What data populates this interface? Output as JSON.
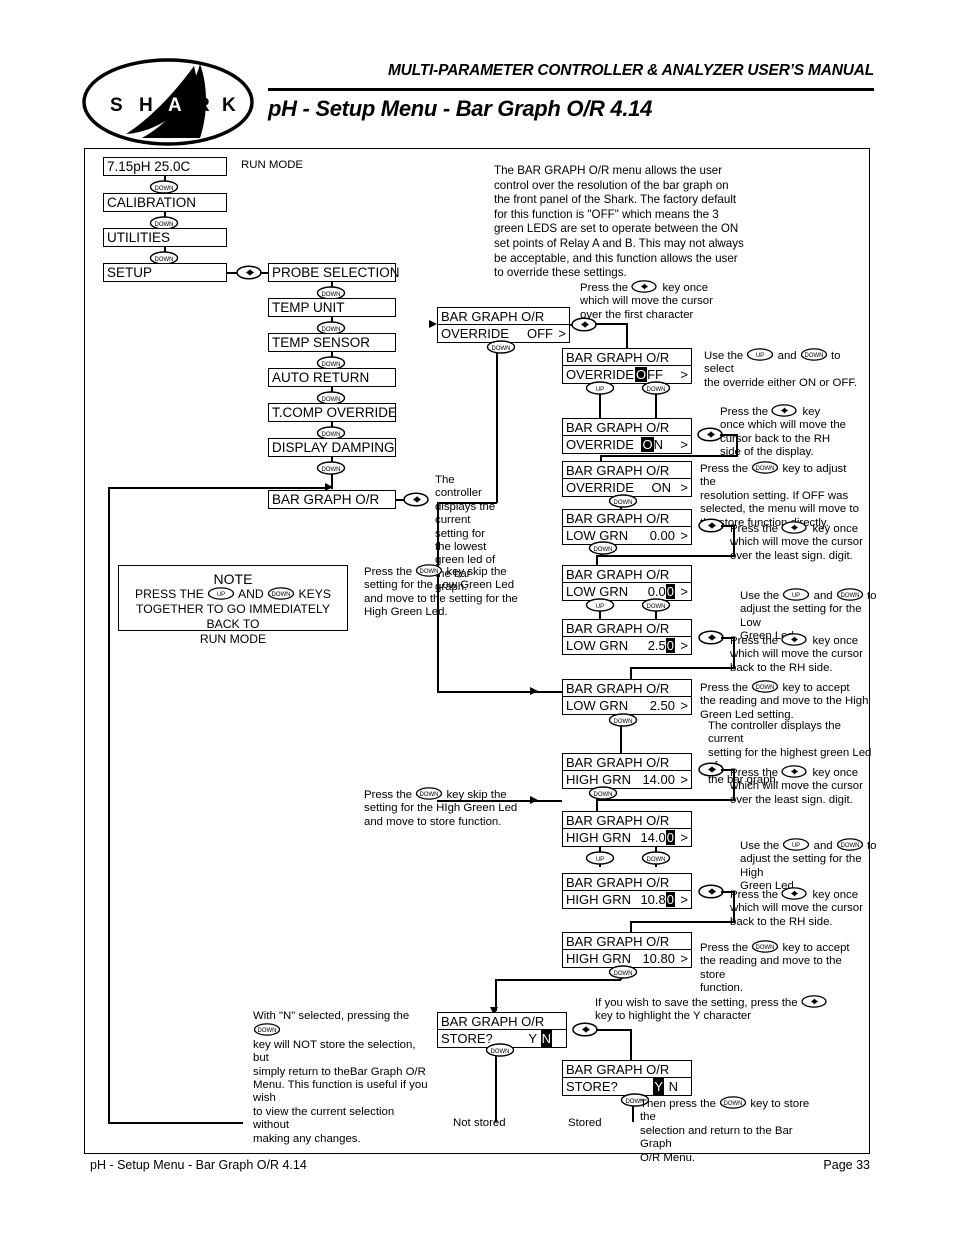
{
  "header": {
    "manual_title": "MULTI-PARAMETER CONTROLLER & ANALYZER USER’S MANUAL",
    "page_title": "pH - Setup Menu - Bar Graph O/R 4.14",
    "logo_text": "SHARK"
  },
  "footer": {
    "left": "pH - Setup Menu - Bar Graph O/R 4.14",
    "right": "Page 33"
  },
  "keys": {
    "up": "UP",
    "down": "DOWN",
    "left_right": "left-right"
  },
  "intro": "The BAR GRAPH O/R menu allows the user control over the resolution of the bar graph on the front panel of the Shark. The factory default for this function is \"OFF\" which means the 3  green LEDS are set to operate between the ON set points of Relay A and B.  This may not always be acceptable, and this function allows the user to override these settings.",
  "run_mode_label": "RUN MODE",
  "left_menu": [
    {
      "label": "7.15pH  25.0C"
    },
    {
      "label": "CALIBRATION"
    },
    {
      "label": "UTILITIES"
    },
    {
      "label": "SETUP"
    }
  ],
  "setup_menu": [
    {
      "label": "PROBE SELECTION"
    },
    {
      "label": "TEMP UNIT"
    },
    {
      "label": "TEMP SENSOR"
    },
    {
      "label": "AUTO RETURN"
    },
    {
      "label": "T.COMP OVERRIDE"
    },
    {
      "label": "DISPLAY DAMPING"
    },
    {
      "label": "BAR GRAPH O/R"
    }
  ],
  "screens": {
    "override_off": {
      "title": "BAR GRAPH O/R",
      "label": "OVERRIDE",
      "value": "OFF",
      "caret": ">"
    },
    "override_off_cursor": {
      "title": "BAR GRAPH O/R",
      "label": "OVERRIDE",
      "cursor_char": "O",
      "rest": "FF",
      "caret": ">"
    },
    "override_on_cursor": {
      "title": "BAR GRAPH O/R",
      "label": "OVERRIDE",
      "cursor_char": "O",
      "rest": "N",
      "caret": ">"
    },
    "override_on": {
      "title": "BAR GRAPH O/R",
      "label": "OVERRIDE",
      "value": "ON",
      "caret": ">"
    },
    "low_grn_000": {
      "title": "BAR GRAPH O/R",
      "label": "LOW GRN",
      "value": "0.00",
      "caret": ">"
    },
    "low_grn_000_cursor": {
      "title": "BAR GRAPH O/R",
      "label": "LOW GRN",
      "prefix": "0.0",
      "cursor_char": "0",
      "caret": ">"
    },
    "low_grn_250_cursor": {
      "title": "BAR GRAPH O/R",
      "label": "LOW GRN",
      "prefix": "2.5",
      "cursor_char": "0",
      "caret": ">"
    },
    "low_grn_250": {
      "title": "BAR GRAPH O/R",
      "label": "LOW GRN",
      "value": "2.50",
      "caret": ">"
    },
    "high_grn_1400": {
      "title": "BAR GRAPH O/R",
      "label": "HIGH GRN",
      "value": "14.00",
      "caret": ">"
    },
    "high_grn_1400_cursor": {
      "title": "BAR GRAPH O/R",
      "label": "HIGH GRN",
      "prefix": "14.0",
      "cursor_char": "0",
      "caret": ">"
    },
    "high_grn_1080_cursor": {
      "title": "BAR GRAPH O/R",
      "label": "HIGH GRN",
      "prefix": "10.8",
      "cursor_char": "0",
      "caret": ">"
    },
    "high_grn_1080": {
      "title": "BAR GRAPH O/R",
      "label": "HIGH GRN",
      "value": "10.80",
      "caret": ">"
    },
    "store_n": {
      "title": "BAR GRAPH O/R",
      "label": "STORE?",
      "yes": "Y",
      "no": "N"
    },
    "store_y": {
      "title": "BAR GRAPH O/R",
      "label": "STORE?",
      "yes": "Y",
      "no": "N"
    }
  },
  "annotations": {
    "press_lr_first_char": {
      "a": "Press the",
      "b": "key once",
      "c": "which will move the cursor",
      "d": "over the first character"
    },
    "use_up_down_override": {
      "a": "Use the",
      "b": "and",
      "c": "to select",
      "d": "the override either ON or OFF."
    },
    "press_lr_back_rh_display": {
      "a": "Press the",
      "b": "key",
      "c": "once which will move the",
      "d": "cursor back to the RH",
      "e": "side of the display."
    },
    "press_down_resolution": {
      "a": "Press the",
      "b": "key to adjust the",
      "c": "resolution setting. If OFF was",
      "d": "selected, the menu will move to",
      "e": "the store function directly."
    },
    "controller_lowest_green": "The controller displays the current setting for the lowest green led of the bar graph.",
    "press_lr_least_sig_1": {
      "a": "Press the",
      "b": "key once",
      "c": "which will move the cursor",
      "d": "over the least sign. digit."
    },
    "use_up_down_low": {
      "a": "Use the",
      "b": "and",
      "c": "to",
      "d": "adjust the setting for the Low",
      "e": "Green Led."
    },
    "press_lr_back_rh_1": {
      "a": "Press the",
      "b": "key once",
      "c": "which will move the cursor",
      "d": "back to the RH side."
    },
    "press_down_accept_high": {
      "a": "Press the",
      "b": "key to accept",
      "c": "the reading and move to the High",
      "d": "Green Led setting."
    },
    "controller_highest_green": {
      "a": "The controller displays the current",
      "b": "setting for the highest green Led of",
      "c": "the bar graph."
    },
    "press_lr_least_sig_2": {
      "a": "Press the",
      "b": "key once",
      "c": "which will move the cursor",
      "d": "over the least sign. digit."
    },
    "use_up_down_high": {
      "a": "Use the",
      "b": "and",
      "c": "to",
      "d": "adjust the setting for the High",
      "e": "Green Led."
    },
    "press_lr_back_rh_2": {
      "a": "Press the",
      "b": "key once",
      "c": "which will move the cursor",
      "d": "back to the RH side."
    },
    "press_down_accept_store": {
      "a": "Press the",
      "b": "key to accept",
      "c": "the reading and move to the store",
      "d": "function."
    },
    "skip_low_green": {
      "a": "Press the",
      "b": "key skip the",
      "c": "setting for the Low Green Led",
      "d": "and move to the setting for the",
      "e": "High Green Led."
    },
    "skip_high_green": {
      "a": "Press the",
      "b": "key skip the",
      "c": "setting for the HIgh Green Led",
      "d": "and move to store function."
    },
    "save_highlight_y": {
      "a": "If you wish to save the setting, press the",
      "b": "key to highlight the Y character"
    },
    "then_press_store": {
      "a": "Then press the",
      "b": "key to store the",
      "c": "selection and return to the Bar Graph",
      "d": "O/R Menu."
    },
    "with_n_selected": {
      "a": "With \"N\" selected, pressing the",
      "b": "key will NOT store the selection, but",
      "c": "simply return to theBar Graph O/R",
      "d": "Menu. This function is useful if you wish",
      "e": "to view the current selection without",
      "f": "making any changes."
    },
    "not_stored": "Not stored",
    "stored": "Stored"
  },
  "note": {
    "title": "NOTE",
    "line1_a": "PRESS THE",
    "line1_b": "AND",
    "line1_c": "KEYS",
    "line2": "TOGETHER TO GO IMMEDIATELY BACK TO",
    "line3": "RUN MODE"
  }
}
